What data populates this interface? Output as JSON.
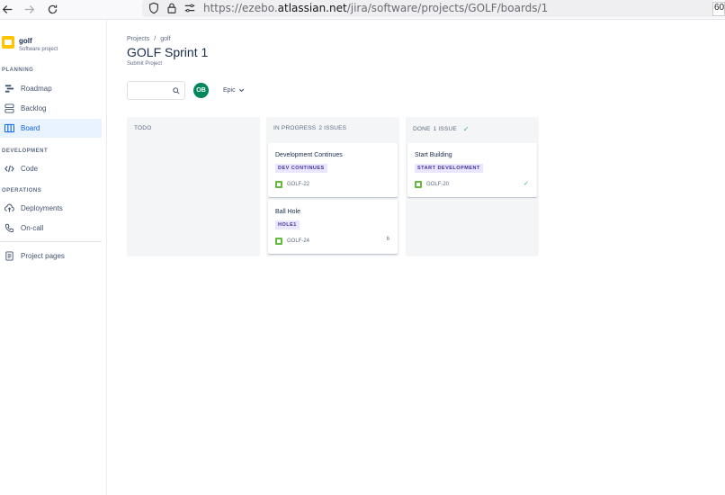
{
  "browser": {
    "url_prefix": "https://ezebo.",
    "url_host": "atlassian.net",
    "url_path": "/jira/software/projects/GOLF/boards/1",
    "zoom": "60%"
  },
  "sidebar": {
    "project_name": "golf",
    "project_type": "Software project",
    "sections": {
      "planning": "PLANNING",
      "development": "DEVELOPMENT",
      "operations": "OPERATIONS"
    },
    "items": [
      {
        "label": "Roadmap",
        "icon": "roadmap-icon"
      },
      {
        "label": "Backlog",
        "icon": "backlog-icon"
      },
      {
        "label": "Board",
        "icon": "board-icon",
        "active": true
      },
      {
        "label": "Code",
        "icon": "code-icon"
      },
      {
        "label": "Deployments",
        "icon": "deployments-icon"
      },
      {
        "label": "On-call",
        "icon": "on-call-icon"
      },
      {
        "label": "Project pages",
        "icon": "pages-icon"
      }
    ]
  },
  "header": {
    "breadcrumb": [
      "Projects",
      "/",
      "golf"
    ],
    "title": "GOLF Sprint 1",
    "subtitle": "Submit Project"
  },
  "filters": {
    "avatar_initials": "OB",
    "epic_label": "Epic"
  },
  "colors": {
    "accent": "#0c66e4",
    "avatar": "#00875a",
    "label_bg": "#eae6ff",
    "story": "#63ba3c",
    "done_check": "#36b37e"
  },
  "columns": [
    {
      "title": "TODO",
      "count": ""
    },
    {
      "title": "IN PROGRESS",
      "count": "2 ISSUES"
    },
    {
      "title": "DONE",
      "count": "1 ISSUE",
      "done": true
    }
  ],
  "cards": [
    {
      "title": "Development Continues",
      "label": "DEV CONTINUES",
      "key": "GOLF-22",
      "right": ""
    },
    {
      "title": "Ball Hole",
      "label": "HOLE1",
      "key": "GOLF-24",
      "right": "6"
    },
    {
      "title": "Start Building",
      "label": "START DEVELOPMENT",
      "key": "GOLF-20",
      "right": "✓"
    }
  ]
}
